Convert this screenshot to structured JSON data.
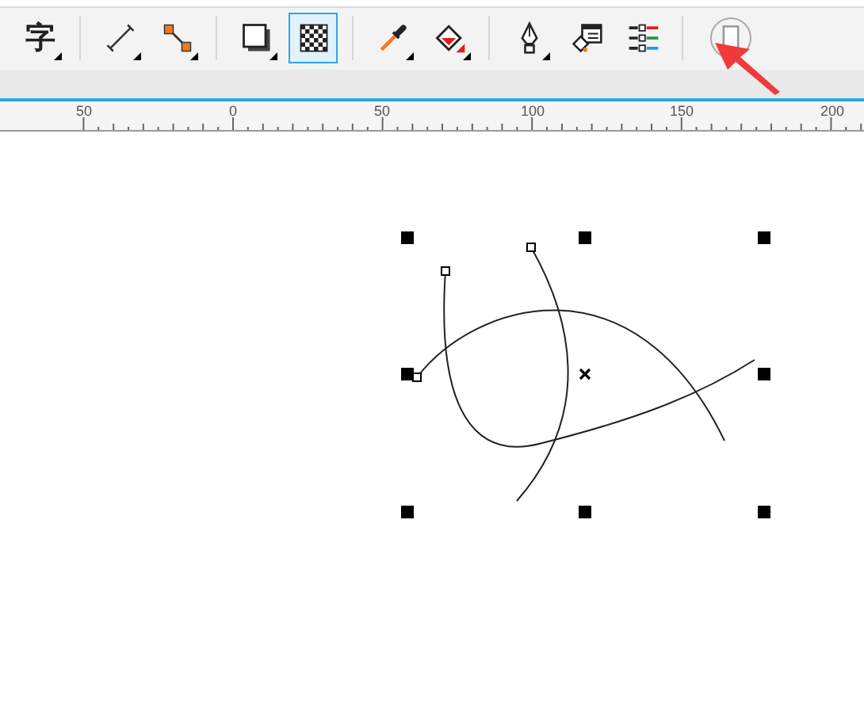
{
  "toolbar": {
    "tools": [
      {
        "kind": "text",
        "label": "字",
        "selected": false,
        "flyout": true
      },
      {
        "kind": "divider"
      },
      {
        "kind": "dimension",
        "selected": false,
        "flyout": true
      },
      {
        "kind": "connector",
        "selected": false,
        "flyout": true
      },
      {
        "kind": "divider"
      },
      {
        "kind": "shadow",
        "selected": false,
        "flyout": true
      },
      {
        "kind": "transparency",
        "selected": true
      },
      {
        "kind": "divider"
      },
      {
        "kind": "eyedropper",
        "selected": false,
        "flyout": true
      },
      {
        "kind": "fill",
        "selected": false,
        "flyout": true
      },
      {
        "kind": "divider"
      },
      {
        "kind": "pen",
        "selected": false,
        "flyout": true
      },
      {
        "kind": "properties",
        "selected": false
      },
      {
        "kind": "align",
        "selected": false
      },
      {
        "kind": "divider"
      },
      {
        "kind": "page",
        "selected": false,
        "highlighted": true
      }
    ]
  },
  "ruler": {
    "labels": [
      "50",
      "0",
      "50",
      "100",
      "150",
      "200"
    ]
  }
}
